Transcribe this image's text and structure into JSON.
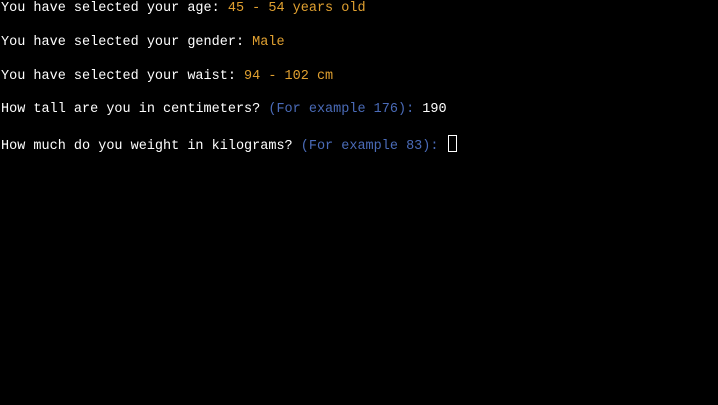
{
  "terminal": {
    "lines": [
      {
        "prompt": "You have selected your age: ",
        "answer": "45 - 54 years old"
      },
      {
        "prompt": "You have selected your gender: ",
        "answer": "Male"
      },
      {
        "prompt": "You have selected your waist: ",
        "answer": "94 - 102 cm"
      },
      {
        "prompt": "How tall are you in centimeters? ",
        "hint": "(For example 176):",
        "input": " 190"
      },
      {
        "prompt": "How much do you weight in kilograms? ",
        "hint": "(For example 83):",
        "input": " "
      }
    ]
  },
  "colors": {
    "background": "#000000",
    "text": "#ffffff",
    "answer": "#e0a030",
    "hint": "#4a6bb8"
  }
}
